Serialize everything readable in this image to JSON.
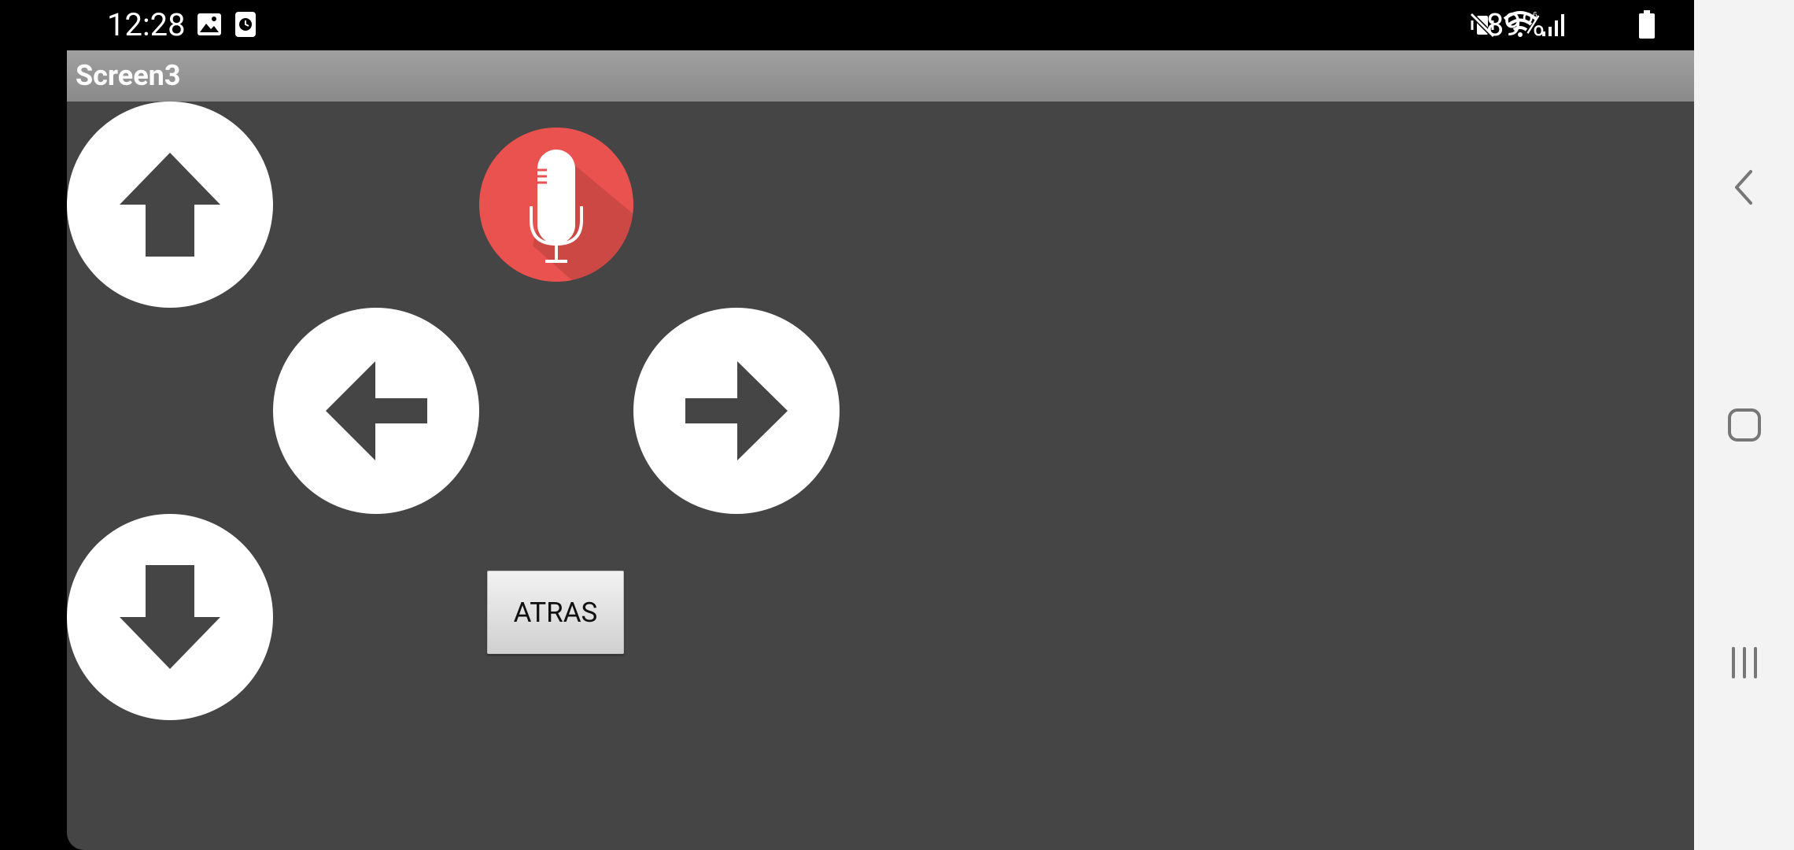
{
  "status_bar": {
    "time": "12:28",
    "battery_percent": "89%",
    "icons": [
      "image-icon",
      "clock-icon",
      "mute-vibrate-icon",
      "wifi-icon",
      "signal-icon",
      "battery-icon"
    ]
  },
  "app": {
    "title": "Screen3",
    "background_color": "#454545",
    "buttons": {
      "up": "arrow-up-icon",
      "left": "arrow-left-icon",
      "right": "arrow-right-icon",
      "down": "arrow-down-icon",
      "mic": "microphone-icon",
      "atras_label": "ATRAS"
    },
    "mic_color": "#e9524f"
  },
  "nav_bar": {
    "icons": [
      "back-icon",
      "home-icon",
      "recent-apps-icon"
    ]
  }
}
